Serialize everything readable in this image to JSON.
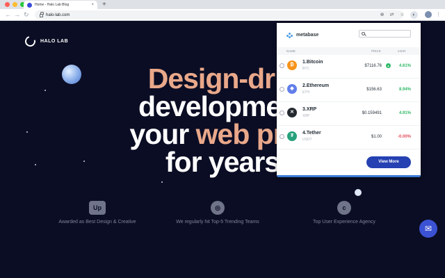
{
  "browser": {
    "tab_title": "Home - Halo Lab Blog",
    "tab_close": "×",
    "new_tab": "+",
    "back": "←",
    "forward": "→",
    "reload": "↻",
    "url": "halo-lab.com"
  },
  "site": {
    "logo_text": "HALO LAB",
    "headline": [
      {
        "parts": [
          {
            "text": "Design-driv",
            "color": "peach"
          }
        ]
      },
      {
        "parts": [
          {
            "text": "development",
            "color": "white"
          }
        ]
      },
      {
        "parts": [
          {
            "text": "your ",
            "color": "white"
          },
          {
            "text": "web proc",
            "color": "peach"
          }
        ]
      },
      {
        "parts": [
          {
            "text": "for years",
            "color": "white"
          }
        ]
      }
    ],
    "awards": [
      {
        "icon": "Up",
        "text": "Awarded as Best Design & Creative"
      },
      {
        "icon": "◎",
        "text": "We regularly hit Top-5 Trending Teams"
      },
      {
        "icon": "c",
        "text": "Top User Experience Agency"
      }
    ],
    "messenger_icon": "✉"
  },
  "popup": {
    "brand": "metabase",
    "columns": {
      "name": "NAME",
      "price": "PRICE",
      "change": "24HR"
    },
    "coins": [
      {
        "name": "1.Bitcoin",
        "symbol": "BTC",
        "price": "$7116.76",
        "change": "4.61%",
        "icon": "₿",
        "color": "#f7931a",
        "trend": "up"
      },
      {
        "name": "2.Ethereum",
        "symbol": "ETH",
        "price": "$156.63",
        "change": "8.94%",
        "icon": "◆",
        "color": "#627eea",
        "trend": "up"
      },
      {
        "name": "3.XRP",
        "symbol": "XRP",
        "price": "$0.159491",
        "change": "4.91%",
        "icon": "✕",
        "color": "#23292f",
        "trend": "up"
      },
      {
        "name": "4.Tether",
        "symbol": "USDT",
        "price": "$1.00",
        "change": "-0.00%",
        "icon": "₮",
        "color": "#26a17b",
        "trend": "down"
      }
    ],
    "view_more": "View More"
  }
}
